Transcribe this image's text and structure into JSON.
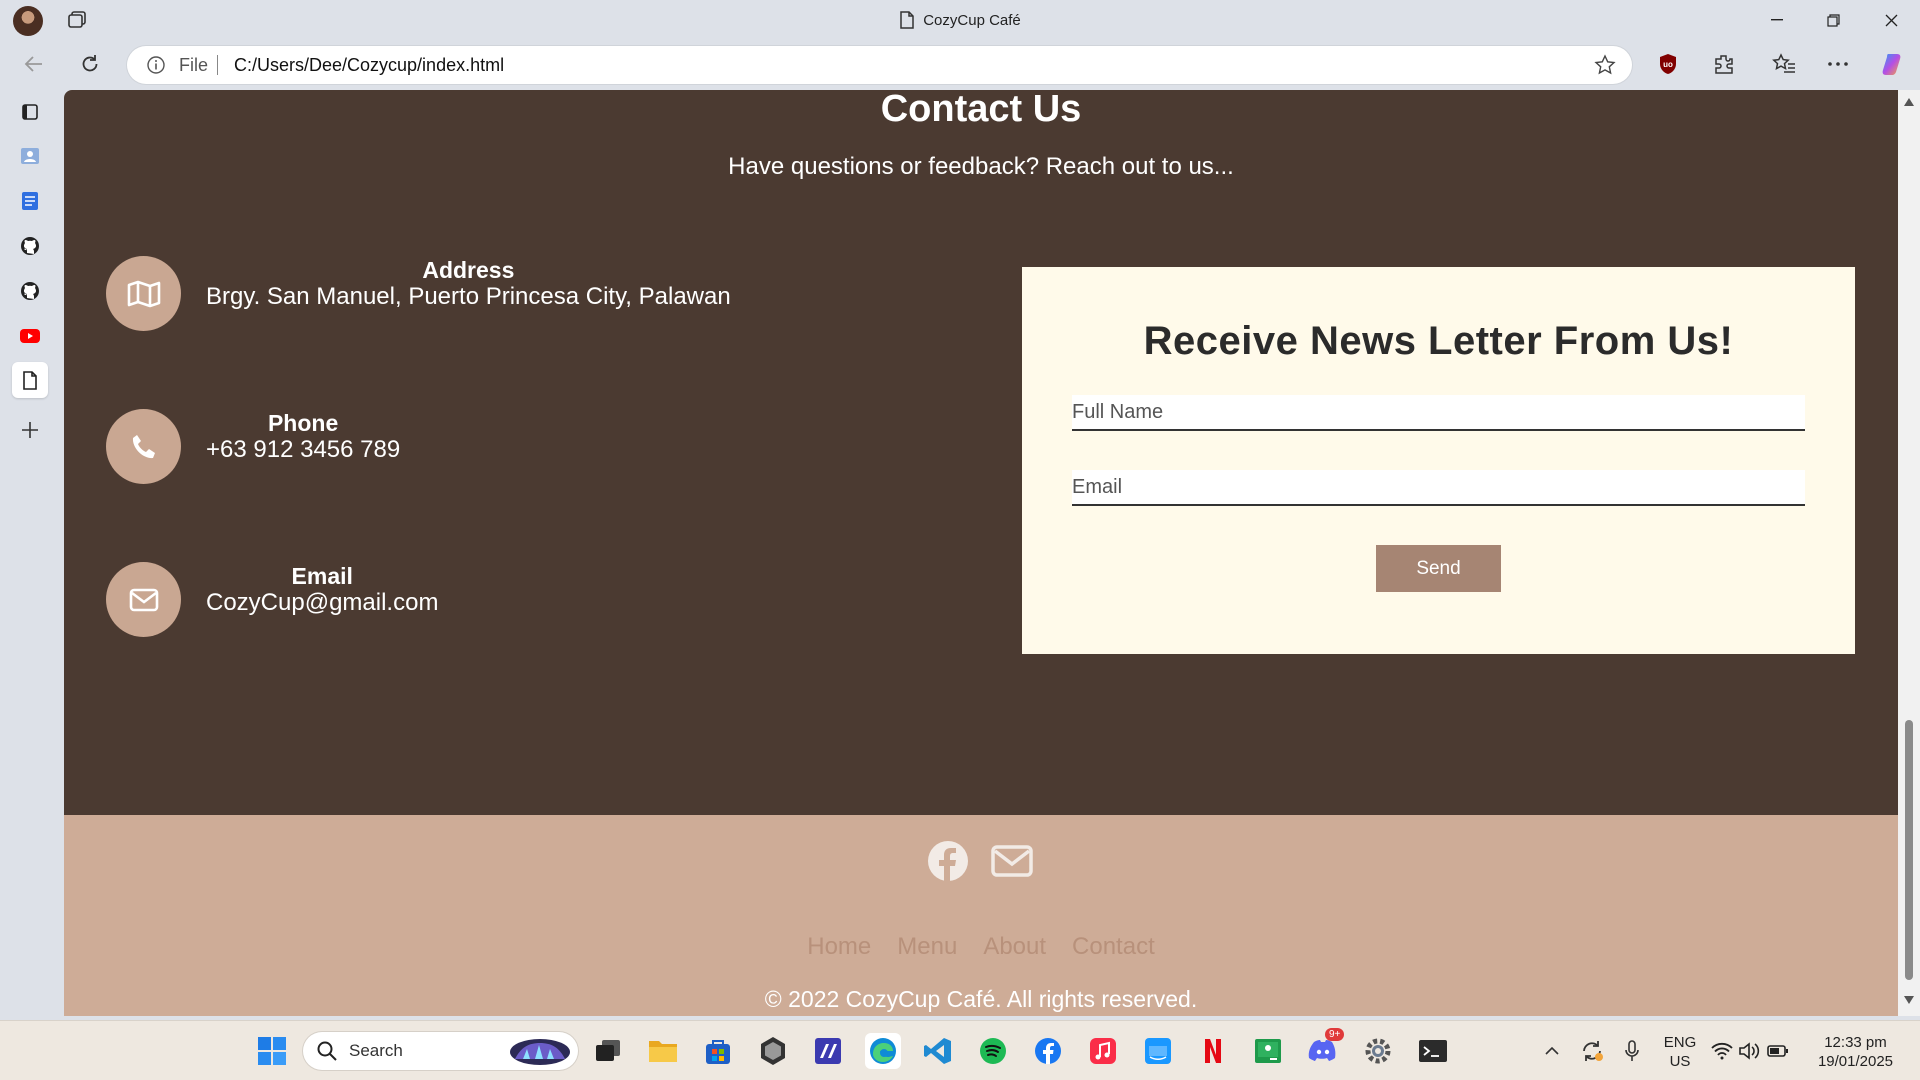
{
  "browser": {
    "tab_title": "CozyCup Café",
    "url_scheme_label": "File",
    "url": "C:/Users/Dee/Cozycup/index.html"
  },
  "page": {
    "contact": {
      "title": "Contact Us",
      "subtitle": "Have questions or feedback? Reach out to us...",
      "items": [
        {
          "label": "Address",
          "value": "Brgy. San Manuel, Puerto Princesa City, Palawan",
          "icon": "map-icon"
        },
        {
          "label": "Phone",
          "value": "+63 912 3456 789",
          "icon": "phone-icon"
        },
        {
          "label": "Email",
          "value": "CozyCup@gmail.com",
          "icon": "envelope-icon"
        }
      ]
    },
    "newsletter": {
      "title": "Receive News Letter From Us!",
      "name_placeholder": "Full Name",
      "email_placeholder": "Email",
      "send_label": "Send"
    },
    "footer": {
      "social": [
        "facebook-icon",
        "envelope-icon"
      ],
      "nav": [
        "Home",
        "Menu",
        "About",
        "Contact"
      ],
      "copyright": "© 2022 CozyCup Café. All rights reserved."
    }
  },
  "taskbar": {
    "search_placeholder": "Search",
    "language": "ENG",
    "region": "US",
    "time": "12:33 pm",
    "date": "19/01/2025",
    "discord_badge": "9+"
  },
  "colors": {
    "contact_bg": "#4b3a31",
    "accent": "#c9a792",
    "newsletter_bg": "#fffaea",
    "button_bg": "#a68573",
    "footer_bg": "#ceac97",
    "footer_link": "#b8917b"
  }
}
